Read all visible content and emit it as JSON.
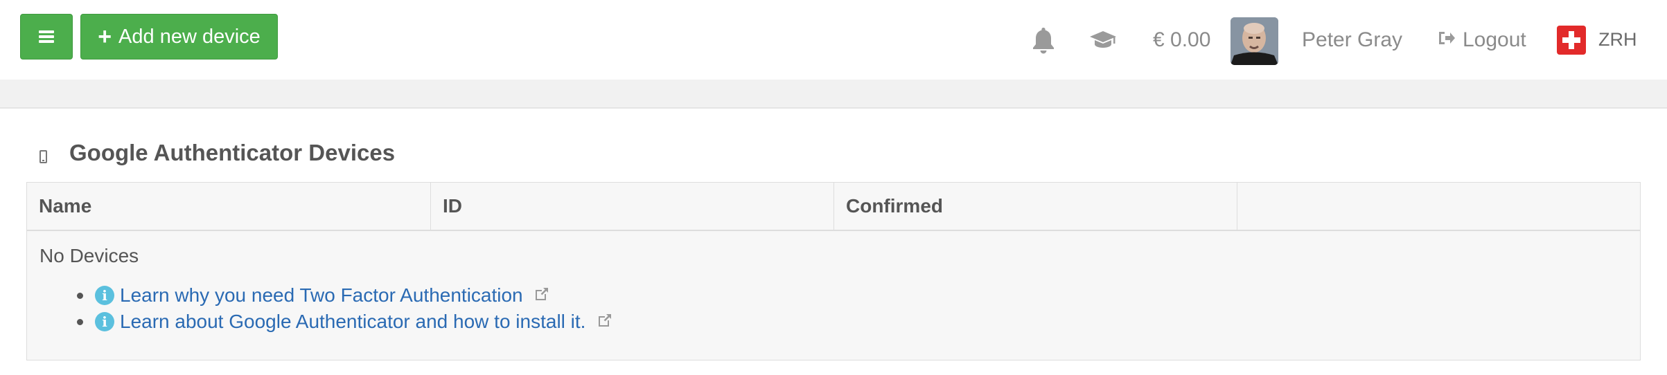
{
  "navbar": {
    "menu_button_label": "",
    "add_device_label": "Add new device",
    "add_device_icon": "+",
    "notification_icon": "bell-icon",
    "academy_icon": "graduation-cap-icon",
    "balance": "€ 0.00",
    "user_name": "Peter Gray",
    "logout_label": "Logout",
    "region_code": "ZRH",
    "region_flag": "switzerland-flag-icon"
  },
  "panel": {
    "title": "Google Authenticator Devices",
    "table": {
      "columns": [
        "Name",
        "ID",
        "Confirmed",
        ""
      ],
      "empty_message": "No Devices"
    },
    "links": [
      {
        "text": "Learn why you need Two Factor Authentication"
      },
      {
        "text": "Learn about Google Authenticator and how to install it."
      }
    ]
  },
  "colors": {
    "primary_green": "#4cae4c",
    "link_blue": "#2a6ab3",
    "info_cyan": "#5bc0de",
    "flag_red": "#e22a2a"
  }
}
